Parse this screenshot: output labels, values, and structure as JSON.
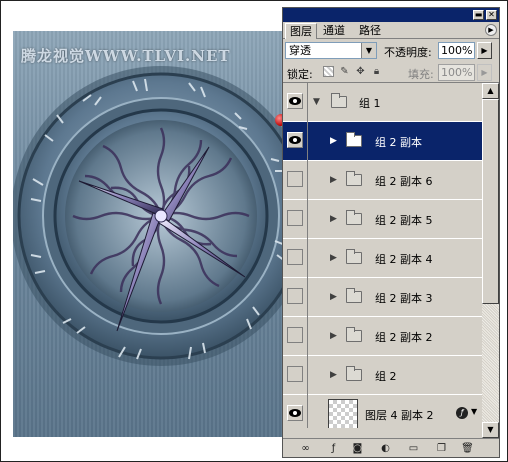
{
  "artwork": {
    "watermark": "腾龙视觉WWW.TLVI.NET"
  },
  "panel": {
    "tabs": [
      "图层",
      "通道",
      "路径"
    ],
    "blend_mode": "穿透",
    "opacity_label": "不透明度:",
    "opacity_value": "100%",
    "lock_label": "锁定:",
    "fill_label": "填充:",
    "fill_value": "100%",
    "layers": [
      {
        "name": "组 1",
        "visible": true,
        "type": "group",
        "expanded": true,
        "indent": 0
      },
      {
        "name": "组 2 副本",
        "visible": true,
        "type": "group",
        "expanded": false,
        "indent": 1,
        "selected": true
      },
      {
        "name": "组 2 副本 6",
        "visible": false,
        "type": "group",
        "indent": 1
      },
      {
        "name": "组 2 副本 5",
        "visible": false,
        "type": "group",
        "indent": 1
      },
      {
        "name": "组 2 副本 4",
        "visible": false,
        "type": "group",
        "indent": 1
      },
      {
        "name": "组 2 副本 3",
        "visible": false,
        "type": "group",
        "indent": 1
      },
      {
        "name": "组 2 副本 2",
        "visible": false,
        "type": "group",
        "indent": 1
      },
      {
        "name": "组 2",
        "visible": false,
        "type": "group",
        "indent": 1
      },
      {
        "name": "图层 4 副本 2",
        "visible": true,
        "type": "layer",
        "has_fx": true
      }
    ],
    "bottom_icons": [
      "link-icon",
      "layer-style-icon",
      "mask-icon",
      "adjustment-icon",
      "new-group-icon",
      "new-layer-icon",
      "trash-icon"
    ]
  },
  "colors": {
    "selection": "#0a246a",
    "panel_bg": "#d4d0c8"
  }
}
